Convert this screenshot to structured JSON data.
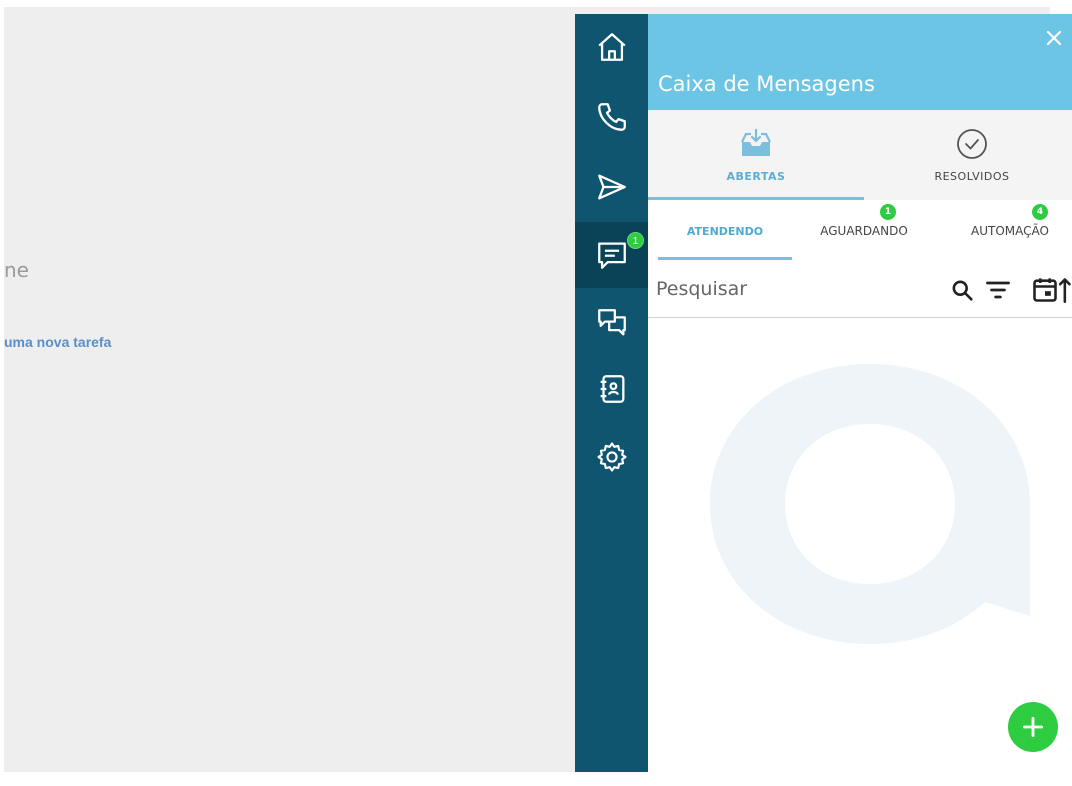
{
  "background": {
    "heading_fragment": "ne",
    "link_fragment": "uma nova tarefa"
  },
  "rail": {
    "items": [
      {
        "name": "home",
        "icon": "home-icon"
      },
      {
        "name": "phone",
        "icon": "phone-icon"
      },
      {
        "name": "send",
        "icon": "send-icon"
      },
      {
        "name": "messages",
        "icon": "chat-icon",
        "badge": "1",
        "active": true
      },
      {
        "name": "conversations",
        "icon": "conversations-icon"
      },
      {
        "name": "contacts",
        "icon": "contacts-book-icon"
      },
      {
        "name": "settings",
        "icon": "gear-icon"
      }
    ]
  },
  "panel": {
    "title": "Caixa de Mensagens",
    "main_tabs": [
      {
        "label": "ABERTAS",
        "icon": "inbox-icon",
        "active": true
      },
      {
        "label": "RESOLVIDOS",
        "icon": "check-circle-icon",
        "active": false
      }
    ],
    "sub_tabs": [
      {
        "label": "ATENDENDO",
        "active": true
      },
      {
        "label": "AGUARDANDO",
        "badge": "1"
      },
      {
        "label": "AUTOMAÇÃO",
        "badge": "4"
      }
    ],
    "search": {
      "placeholder": "Pesquisar"
    }
  },
  "colors": {
    "rail": "#0f5570",
    "header": "#6cc5e5",
    "accent": "#5aaed3",
    "badge": "#2ecc40"
  }
}
